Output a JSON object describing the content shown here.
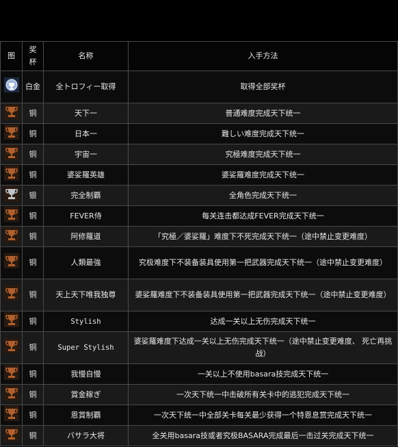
{
  "header": {
    "col_icon": "图",
    "col_cup": "奖杯",
    "col_name": "名称",
    "col_method": "入手方法"
  },
  "rows": [
    {
      "icon": "platinum-trophy-icon",
      "cup": "白金",
      "name": "全トロフィー取得",
      "method": "取得全部奖杯"
    },
    {
      "icon": "bronze-trophy-icon",
      "cup": "铜",
      "name": "天下一",
      "method": "普通难度完成天下统一"
    },
    {
      "icon": "bronze-trophy-icon",
      "cup": "铜",
      "name": "日本一",
      "method": "難しい难度完成天下统一"
    },
    {
      "icon": "bronze-trophy-icon",
      "cup": "铜",
      "name": "宇宙一",
      "method": "究極难度完成天下统一"
    },
    {
      "icon": "bronze-trophy-icon",
      "cup": "铜",
      "name": "婆娑羅英雄",
      "method": "婆娑羅难度完成天下统一"
    },
    {
      "icon": "silver-trophy-icon",
      "cup": "银",
      "name": "完全制覇",
      "method": "全角色完成天下统一"
    },
    {
      "icon": "bronze-trophy-icon",
      "cup": "铜",
      "name": "FEVER侍",
      "method": "每关连击都达成FEVER完成天下统一"
    },
    {
      "icon": "bronze-trophy-icon",
      "cup": "铜",
      "name": "阿修羅道",
      "method": "「究極／婆娑羅」难度下不死完成天下统一（途中禁止变更难度）"
    },
    {
      "icon": "bronze-trophy-icon",
      "cup": "铜",
      "name": "人類最強",
      "method": "究极难度下不装备装具使用第一把武器完成天下统一（途中禁止变更难度）"
    },
    {
      "icon": "bronze-trophy-icon",
      "cup": "铜",
      "name": "天上天下唯我独尊",
      "method": "婆娑羅难度下不装备装具使用第一把武器完成天下统一（途中禁止变更难度）"
    },
    {
      "icon": "bronze-trophy-icon",
      "cup": "铜",
      "name": "Stylish",
      "method": "达成一关以上无伤完成天下统一"
    },
    {
      "icon": "bronze-trophy-icon",
      "cup": "铜",
      "name": "Super Stylish",
      "method": "婆娑羅难度下达成一关以上无伤完成天下统一（途中禁止变更难度、 死亡再挑战）"
    },
    {
      "icon": "bronze-trophy-icon",
      "cup": "铜",
      "name": "我慢自慢",
      "method": "一关以上不使用basara技完成天下统一"
    },
    {
      "icon": "bronze-trophy-icon",
      "cup": "铜",
      "name": "賞金稼ぎ",
      "method": "一次天下统一中击破所有关卡中的逃犯完成天下统一"
    },
    {
      "icon": "bronze-trophy-icon",
      "cup": "铜",
      "name": "恩賞制覇",
      "method": "一次天下统一中全部关卡每关最少获得一个特恩息赏完成天下统一"
    },
    {
      "icon": "bronze-trophy-icon",
      "cup": "铜",
      "name": "バサラ大将",
      "method": "全关用basara技或者究极BASARA完成最后一击过关完成天下统一"
    }
  ],
  "colors": {
    "bronze": "#b0602e",
    "silver": "#c0c4c8",
    "platinum": "#9fb4d8",
    "background": "#000000",
    "border": "#4a4a4a"
  }
}
